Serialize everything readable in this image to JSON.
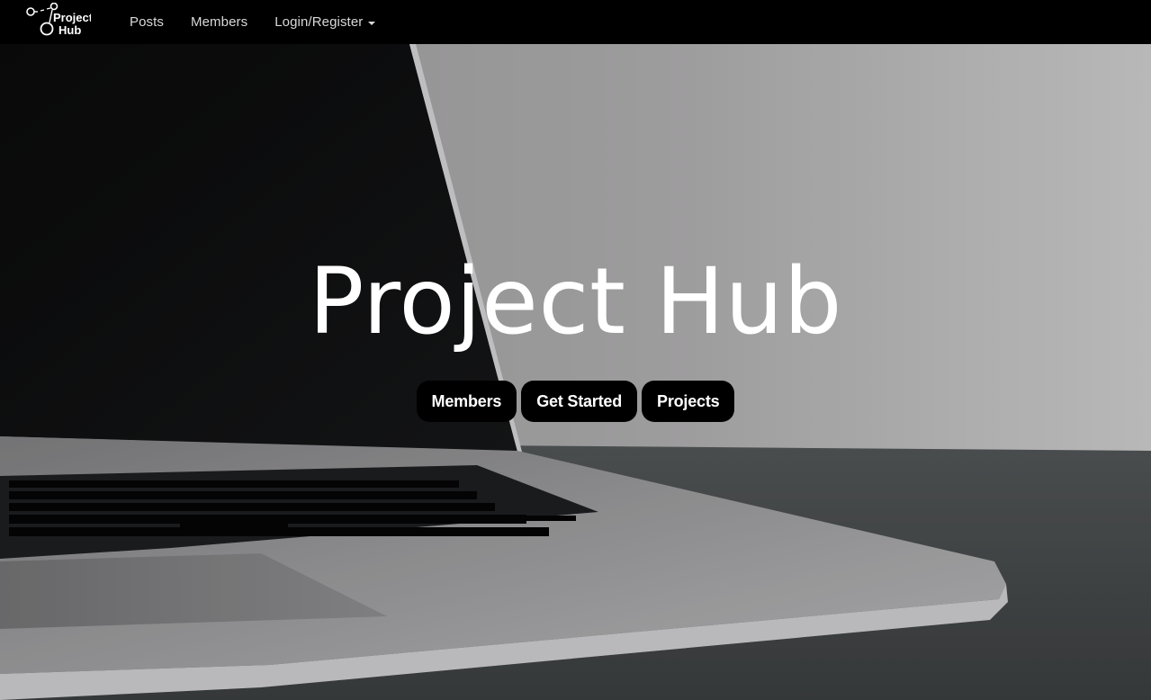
{
  "navbar": {
    "logo_text": [
      "Project",
      "Hub"
    ],
    "links": [
      {
        "label": "Posts"
      },
      {
        "label": "Members"
      },
      {
        "label": "Login/Register"
      }
    ]
  },
  "hero": {
    "title": "Project Hub",
    "buttons": [
      {
        "label": "Members"
      },
      {
        "label": "Get Started"
      },
      {
        "label": "Projects"
      }
    ]
  },
  "colors": {
    "navbar_bg": "#000000",
    "nav_text": "#d9d9d9",
    "hero_title": "#ffffff",
    "button_bg": "#000000",
    "button_text": "#ffffff"
  },
  "icons": [
    "project-hub-logo",
    "caret-down-icon"
  ]
}
